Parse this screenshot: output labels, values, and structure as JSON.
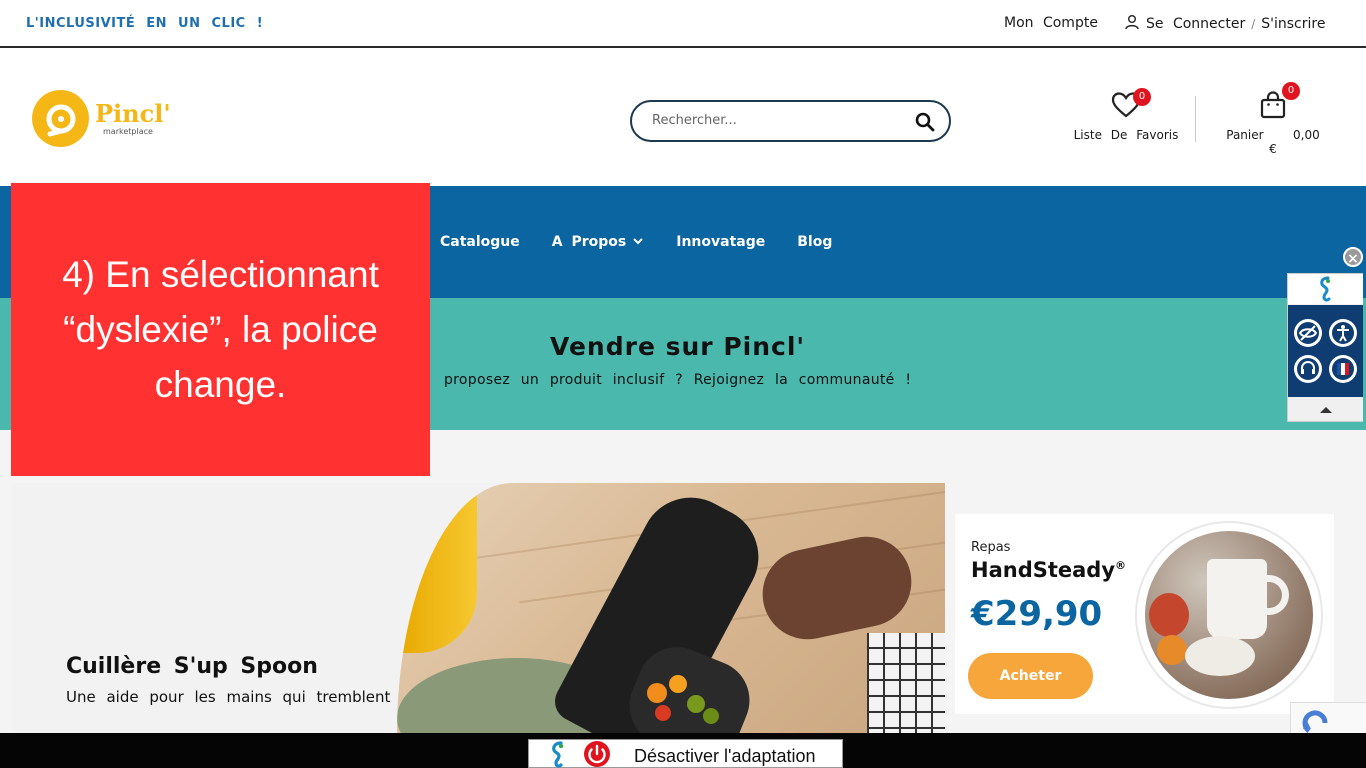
{
  "topbar": {
    "tagline": "L'INCLUSIVITÉ EN UN CLIC !",
    "account": "Mon Compte",
    "login": "Se Connecter",
    "separator": "/",
    "signup": "S'inscrire"
  },
  "header": {
    "logo_name": "Pincl'",
    "logo_sub": "marketplace",
    "search_placeholder": "Rechercher...",
    "wishlist_label": "Liste De Favoris",
    "wishlist_count": "0",
    "cart_label": "Panier",
    "cart_total": "0,00 €",
    "cart_count": "0"
  },
  "nav": {
    "items": [
      {
        "label": "Catalogue"
      },
      {
        "label": "A Propos"
      },
      {
        "label": "Innovatage"
      },
      {
        "label": "Blog"
      }
    ]
  },
  "sell": {
    "title": "Vendre sur Pincl'",
    "subtitle": "proposez un produit inclusif ? Rejoignez la communauté !"
  },
  "hero": {
    "title": "Cuillère S'up Spoon",
    "subtitle": "Une aide pour les mains qui tremblent"
  },
  "product_card": {
    "category": "Repas",
    "name": "HandSteady",
    "trademark": "®",
    "price": "€29,90",
    "button": "Acheter"
  },
  "callout": {
    "text": "4) En sélectionnant “dyslexie”, la police change."
  },
  "accessibility": {
    "close": "×"
  },
  "bottom": {
    "deactivate_label": "Désactiver l'adaptation"
  },
  "colors": {
    "brand_blue": "#0a65a0",
    "teal": "#4ab8ad",
    "logo_yellow": "#f5b715",
    "callout_red": "#ff3131",
    "button_orange": "#f6a63b",
    "badge_red": "#e0141e"
  }
}
